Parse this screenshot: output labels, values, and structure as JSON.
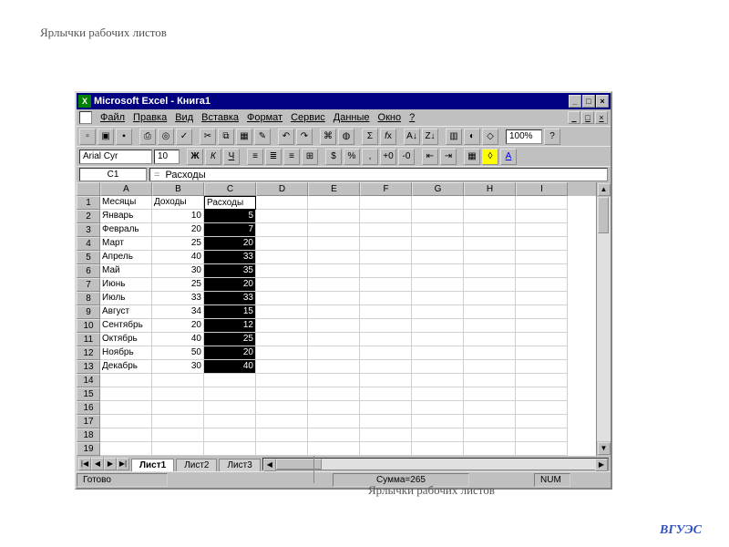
{
  "captions": {
    "top": "Ярлычки рабочих листов",
    "bottom": "Ярлычки рабочих листов"
  },
  "window": {
    "title": "Microsoft Excel - Книга1"
  },
  "menubar": [
    "Файл",
    "Правка",
    "Вид",
    "Вставка",
    "Формат",
    "Сервис",
    "Данные",
    "Окно",
    "?"
  ],
  "font": {
    "name": "Arial Cyr",
    "size": "10"
  },
  "zoom": "100%",
  "namebox": "C1",
  "formula": "Расходы",
  "columns": [
    "A",
    "B",
    "C",
    "D",
    "E",
    "F",
    "G",
    "H",
    "I"
  ],
  "rows": [
    1,
    2,
    3,
    4,
    5,
    6,
    7,
    8,
    9,
    10,
    11,
    12,
    13,
    14,
    15,
    16,
    17,
    18,
    19
  ],
  "table": {
    "headers": {
      "A": "Месяцы",
      "B": "Доходы",
      "C": "Расходы"
    },
    "data": [
      {
        "m": "Январь",
        "d": 10,
        "r": 5
      },
      {
        "m": "Февраль",
        "d": 20,
        "r": 7
      },
      {
        "m": "Март",
        "d": 25,
        "r": 20
      },
      {
        "m": "Апрель",
        "d": 40,
        "r": 33
      },
      {
        "m": "Май",
        "d": 30,
        "r": 35
      },
      {
        "m": "Июнь",
        "d": 25,
        "r": 20
      },
      {
        "m": "Июль",
        "d": 33,
        "r": 33
      },
      {
        "m": "Август",
        "d": 34,
        "r": 15
      },
      {
        "m": "Сентябрь",
        "d": 20,
        "r": 12
      },
      {
        "m": "Октябрь",
        "d": 40,
        "r": 25
      },
      {
        "m": "Ноябрь",
        "d": 50,
        "r": 20
      },
      {
        "m": "Декабрь",
        "d": 30,
        "r": 40
      }
    ]
  },
  "tabs": [
    "Лист1",
    "Лист2",
    "Лист3"
  ],
  "status": {
    "ready": "Готово",
    "sum": "Сумма=265",
    "num": "NUM"
  },
  "logo": "ВГУЭС"
}
